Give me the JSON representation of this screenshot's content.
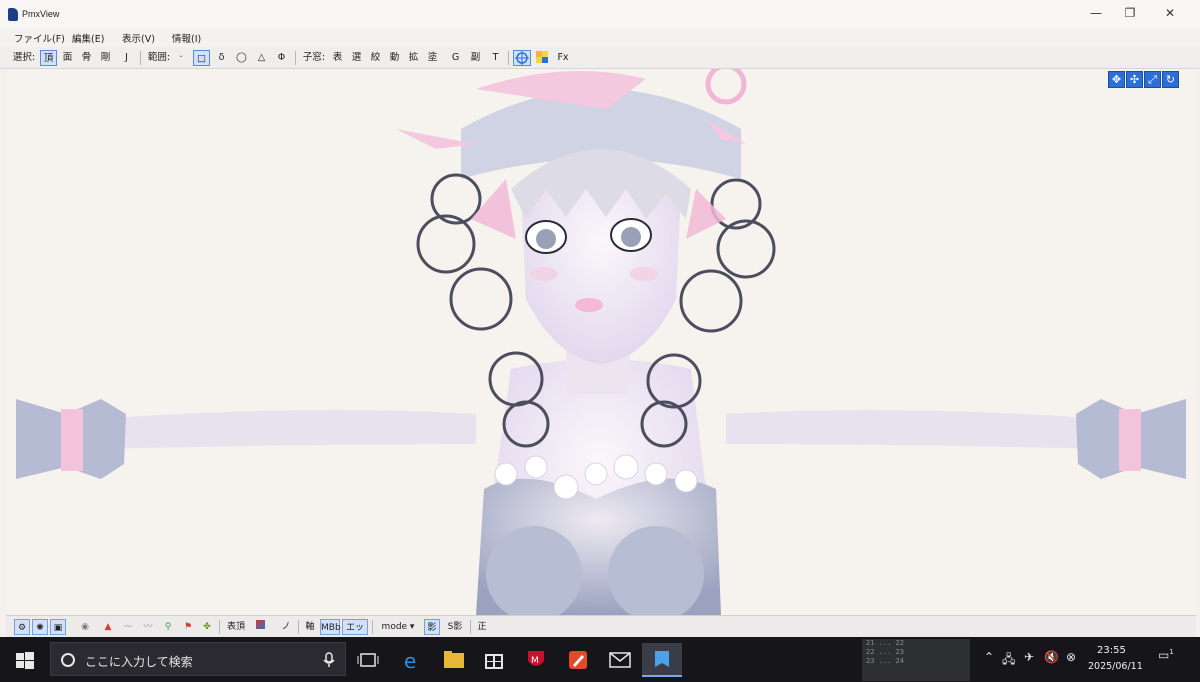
{
  "window": {
    "title": "PmxView",
    "minimize": "—",
    "restore": "❐",
    "close": "✕"
  },
  "menu": [
    {
      "label": "ファイル(F)"
    },
    {
      "label": "編集(E)"
    },
    {
      "label": "表示(V)"
    },
    {
      "label": "情報(I)"
    }
  ],
  "toolbar": {
    "select_label": "選択:",
    "select_items": [
      "頂",
      "面",
      "骨",
      "剛",
      "J"
    ],
    "range_label": "範囲:",
    "range_items": [
      "·",
      "□",
      "δ",
      "◯",
      "△",
      "Φ"
    ],
    "child_label": "子窓:",
    "child_items": [
      "表",
      "選",
      "絞",
      "動",
      "拡",
      "塗",
      "G",
      "副",
      "T"
    ],
    "fx_label": "Fx"
  },
  "bottombar": {
    "items": [
      "表頂",
      "ノミ",
      "軸",
      "MBb",
      "エッジ",
      "mode ▾",
      "影",
      "S影",
      "正"
    ]
  },
  "taskbar": {
    "search_placeholder": "ここに入力して検索",
    "tray_lines": [
      "21 ... 22",
      "22 ... 23",
      "23 ... 24"
    ],
    "time": "23:55",
    "date": "2025/06/11",
    "notification_count": "1"
  },
  "colors": {
    "accent": "#2c6fd6",
    "taskbar": "#16161a",
    "viewport_bg": "#f6f2ee"
  }
}
